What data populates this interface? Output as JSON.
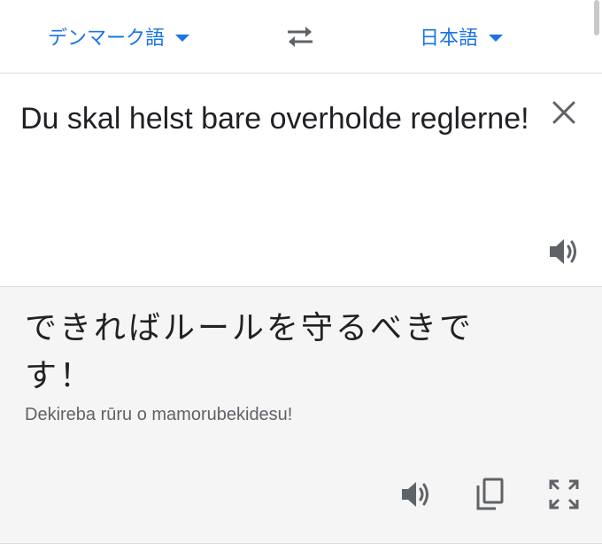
{
  "lang_bar": {
    "source_language": "デンマーク語",
    "target_language": "日本語"
  },
  "source": {
    "text": "Du skal helst bare overholde reglerne!"
  },
  "translation": {
    "text": "できればルールを守るべきです！",
    "romanization": "Dekireba rūru o mamorubekidesu!"
  },
  "icons": {
    "swap": "swap-arrows-icon",
    "clear": "close-icon",
    "source_speaker": "speaker-icon",
    "target_speaker": "speaker-icon",
    "copy": "copy-icon",
    "expand": "fullscreen-icon"
  },
  "colors": {
    "accent": "#1a73e8",
    "text_primary": "#202124",
    "text_secondary": "#5f6368",
    "icon": "#5f6368",
    "translation_bg": "#f5f5f5"
  }
}
